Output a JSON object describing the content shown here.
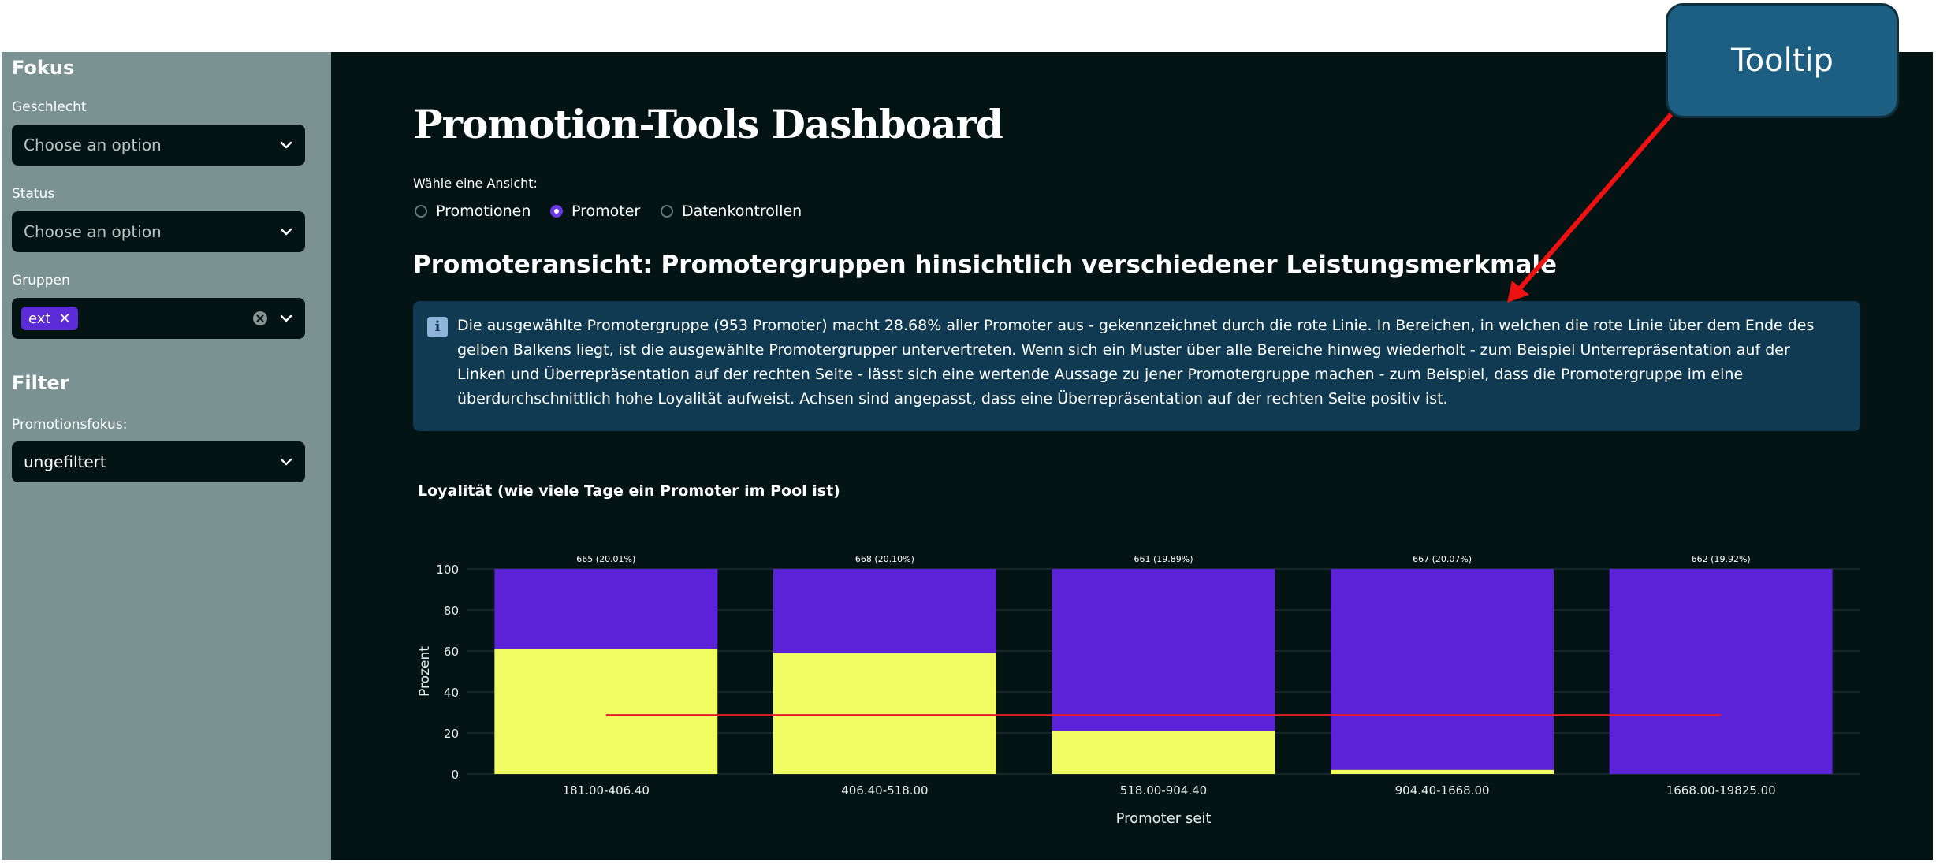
{
  "sidebar": {
    "focus_heading": "Fokus",
    "gender_label": "Geschlecht",
    "gender_value": "Choose an option",
    "status_label": "Status",
    "status_value": "Choose an option",
    "groups_label": "Gruppen",
    "groups_tag": "ext",
    "filter_heading": "Filter",
    "promo_focus_label": "Promotionsfokus:",
    "promo_focus_value": "ungefiltert"
  },
  "main": {
    "title": "Promotion-Tools Dashboard",
    "view_label": "Wähle eine Ansicht:",
    "views": [
      {
        "label": "Promotionen",
        "selected": false
      },
      {
        "label": "Promoter",
        "selected": true
      },
      {
        "label": "Datenkontrollen",
        "selected": false
      }
    ],
    "subtitle": "Promoteransicht: Promotergruppen hinsichtlich verschiedener Leistungsmerkmale",
    "info_text": "Die ausgewählte Promotergruppe (953 Promoter) macht 28.68% aller Promoter aus - gekennzeichnet durch die rote Linie. In Bereichen, in welchen die rote Linie über dem Ende des gelben Balkens liegt, ist die ausgewählte Promotergrupper untervertreten. Wenn sich ein Muster über alle Bereiche hinweg wiederholt - zum Beispiel Unterrepräsentation auf der Linken und Überrepräsentation auf der rechten Seite - lässt sich eine wertende Aussage zu jener Promotergruppe machen - zum Beispiel, dass die Promotergruppe im eine überdurchschnittlich hohe Loyalität aufweist. Achsen sind angepasst, dass eine Überrepräsentation auf der rechten Seite positiv ist.",
    "chart_title": "Loyalität (wie viele Tage ein Promoter im Pool ist)"
  },
  "annotation": {
    "tooltip_label": "Tooltip"
  },
  "colors": {
    "sidebar_bg": "#7a9292",
    "main_bg": "#041414",
    "accent": "#5b2bd8",
    "bar_top": "#5b22d8",
    "bar_bottom": "#f1fd63",
    "reference_line": "#e11d2a",
    "info_bg": "#0f3a52",
    "annotation_arrow": "#ee1111"
  },
  "icons": {
    "dropdown": "chevron-down-icon",
    "clear": "clear-icon",
    "tag_remove": "close-icon",
    "info": "info-icon"
  },
  "chart_data": {
    "type": "bar",
    "stacked": true,
    "categories": [
      "181.00-406.40",
      "406.40-518.00",
      "518.00-904.40",
      "904.40-1668.00",
      "1668.00-19825.00"
    ],
    "bar_labels": [
      "665 (20.01%)",
      "668 (20.10%)",
      "661 (19.89%)",
      "667 (20.07%)",
      "662 (19.92%)"
    ],
    "series": [
      {
        "values": [
          61,
          59,
          21,
          2,
          0
        ]
      },
      {
        "values": [
          39,
          41,
          79,
          98,
          100
        ]
      }
    ],
    "reference_line": 28.68,
    "xlabel": "Promoter seit",
    "ylabel": "Prozent",
    "ylim": [
      0,
      100
    ],
    "yticks": [
      0,
      20,
      40,
      60,
      80,
      100
    ],
    "grid": true
  }
}
